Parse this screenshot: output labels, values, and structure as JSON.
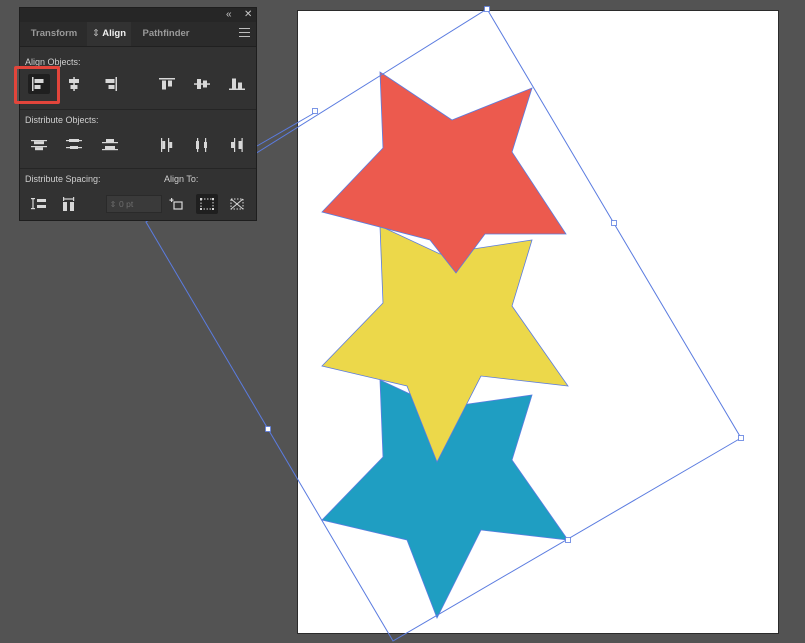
{
  "panel": {
    "collapse_glyph": "«",
    "close_glyph": "✕",
    "tabs": [
      {
        "label": "Transform",
        "active": false
      },
      {
        "label": "Align",
        "prefix": "⇕",
        "active": true
      },
      {
        "label": "Pathfinder",
        "active": false
      }
    ],
    "align_objects_label": "Align Objects:",
    "distribute_objects_label": "Distribute Objects:",
    "distribute_spacing_label": "Distribute Spacing:",
    "align_to_label": "Align To:",
    "spacing_value": "0 pt"
  },
  "colors": {
    "red_star": "#EC5A4E",
    "yellow_star": "#ECD84A",
    "blue_star": "#1F9EC2",
    "selection": "#5B7CE0",
    "highlight": "#E2453B"
  }
}
